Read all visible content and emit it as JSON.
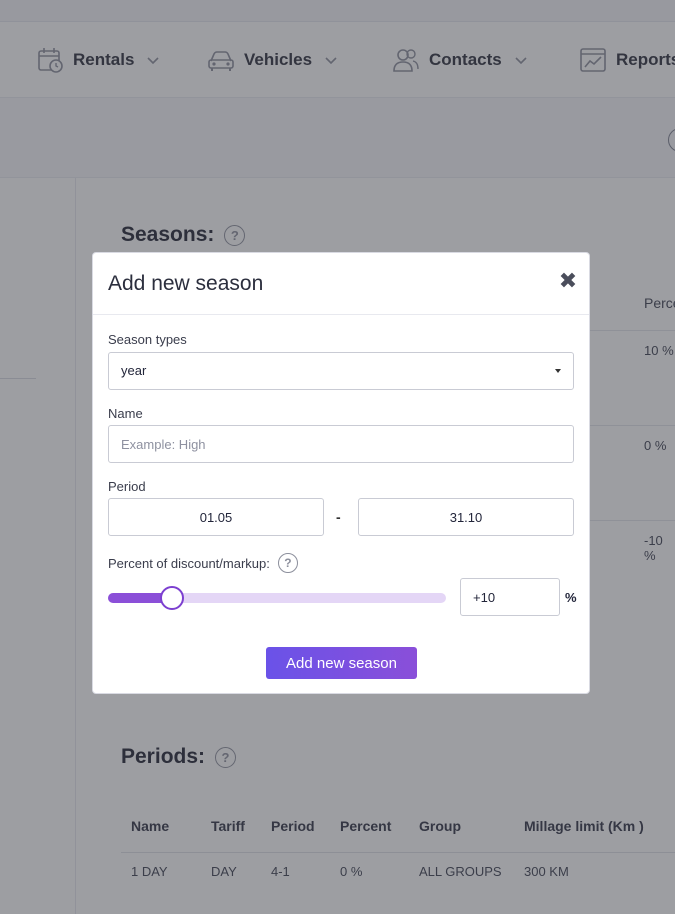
{
  "nav": {
    "items": [
      {
        "label": "Rentals",
        "icon": "calendar-clock-icon"
      },
      {
        "label": "Vehicles",
        "icon": "car-icon"
      },
      {
        "label": "Contacts",
        "icon": "contacts-icon"
      },
      {
        "label": "Reports",
        "icon": "report-chart-icon"
      }
    ]
  },
  "seasons_section": {
    "title": "Seasons:",
    "column_header": "Perce",
    "values": [
      "10 %",
      "0 %",
      "-10 %"
    ]
  },
  "periods_section": {
    "title": "Periods:",
    "columns": [
      "Name",
      "Tariff",
      "Period",
      "Percent",
      "Group",
      "Millage limit (Km )"
    ],
    "rows": [
      [
        "1 DAY",
        "DAY",
        "4-1",
        "0 %",
        "ALL GROUPS",
        "300 KM"
      ]
    ]
  },
  "modal": {
    "title": "Add new season",
    "close_symbol": "✖",
    "season_types_label": "Season types",
    "season_type_value": "year",
    "name_label": "Name",
    "name_value": "",
    "name_placeholder": "Example: High",
    "period_label": "Period",
    "period_from": "01.05",
    "period_separator": "-",
    "period_to": "31.10",
    "discount_label": "Percent of discount/markup:",
    "discount_value": "+10",
    "discount_unit": "%",
    "slider_level_fraction": 0.19,
    "submit_label": "Add new season"
  },
  "colors": {
    "accent_start": "#6a52e8",
    "accent_end": "#8a4fd9",
    "slider_fill": "#8b4fd8",
    "slider_track": "#e4d6f6"
  }
}
